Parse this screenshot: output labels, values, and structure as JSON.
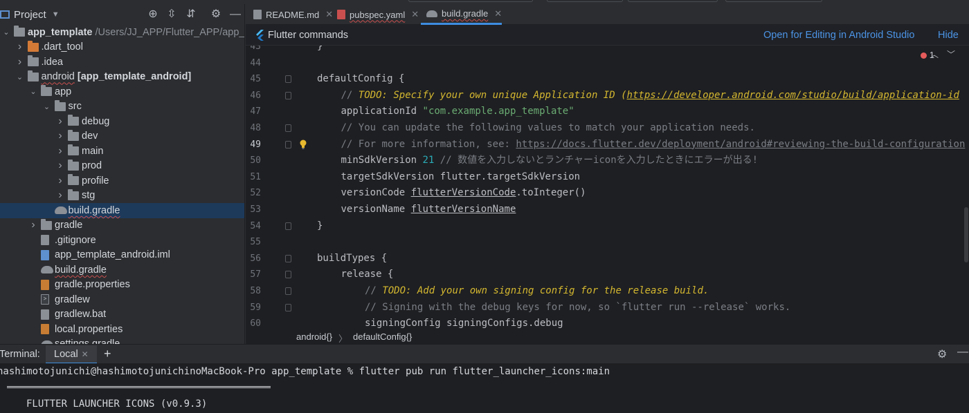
{
  "project_panel": {
    "title": "Project",
    "tree": [
      {
        "label": "app_template",
        "suffix": " /Users/JJ_APP/Flutter_APP/app_",
        "icon": "module-folder-icon",
        "depth": 0,
        "arrow": "expanded",
        "bold": true
      },
      {
        "label": ".dart_tool",
        "icon": "orange-folder-icon",
        "depth": 1,
        "arrow": "collapsed"
      },
      {
        "label": ".idea",
        "icon": "idea-folder-icon",
        "depth": 1,
        "arrow": "collapsed"
      },
      {
        "label": "android",
        "suffix": " [app_template_android]",
        "icon": "module-folder-icon",
        "depth": 1,
        "arrow": "expanded"
      },
      {
        "label": "app",
        "icon": "folder-icon",
        "depth": 2,
        "arrow": "expanded"
      },
      {
        "label": "src",
        "icon": "folder-icon",
        "depth": 3,
        "arrow": "expanded"
      },
      {
        "label": "debug",
        "icon": "folder-icon",
        "depth": 4,
        "arrow": "collapsed"
      },
      {
        "label": "dev",
        "icon": "folder-icon",
        "depth": 4,
        "arrow": "collapsed"
      },
      {
        "label": "main",
        "icon": "folder-icon",
        "depth": 4,
        "arrow": "collapsed"
      },
      {
        "label": "prod",
        "icon": "folder-icon",
        "depth": 4,
        "arrow": "collapsed"
      },
      {
        "label": "profile",
        "icon": "folder-icon",
        "depth": 4,
        "arrow": "collapsed"
      },
      {
        "label": "stg",
        "icon": "folder-icon",
        "depth": 4,
        "arrow": "collapsed"
      },
      {
        "label": "build.gradle",
        "icon": "gradle-icon",
        "depth": 3,
        "arrow": "none",
        "selected": true
      },
      {
        "label": "gradle",
        "icon": "folder-icon",
        "depth": 2,
        "arrow": "collapsed"
      },
      {
        "label": ".gitignore",
        "icon": "gitignore-file-icon",
        "depth": 2,
        "arrow": "none"
      },
      {
        "label": "app_template_android.iml",
        "icon": "iml-file-icon",
        "depth": 2,
        "arrow": "none"
      },
      {
        "label": "build.gradle",
        "icon": "gradle-icon",
        "depth": 2,
        "arrow": "none"
      },
      {
        "label": "gradle.properties",
        "icon": "properties-file-icon",
        "depth": 2,
        "arrow": "none"
      },
      {
        "label": "gradlew",
        "icon": "shell-file-icon",
        "depth": 2,
        "arrow": "none"
      },
      {
        "label": "gradlew.bat",
        "icon": "text-file-icon",
        "depth": 2,
        "arrow": "none"
      },
      {
        "label": "local.properties",
        "icon": "properties-file-icon",
        "depth": 2,
        "arrow": "none"
      },
      {
        "label": "settings.gradle",
        "icon": "gradle-icon",
        "depth": 2,
        "arrow": "none"
      }
    ]
  },
  "tabs": [
    {
      "label": "README.md",
      "icon": "markdown-file-icon"
    },
    {
      "label": "pubspec.yaml",
      "icon": "yaml-file-icon"
    },
    {
      "label": "build.gradle",
      "icon": "gradle-icon",
      "active": true
    }
  ],
  "banner": {
    "title": "Flutter commands",
    "open_link": "Open for Editing in Android Studio",
    "hide_link": "Hide"
  },
  "editor": {
    "error_count": "1",
    "lines": [
      {
        "n": "43",
        "t": [
          {
            "c": "kw",
            "s": "}"
          }
        ],
        "indent": 0
      },
      {
        "n": "44",
        "t": [],
        "indent": 0
      },
      {
        "n": "45",
        "t": [
          {
            "c": "kw",
            "s": "defaultConfig {"
          }
        ],
        "indent": 0,
        "fold": true
      },
      {
        "n": "46",
        "t": [
          {
            "c": "cm",
            "s": "// "
          },
          {
            "c": "todo",
            "s": "TODO: Specify your own unique Application ID ("
          },
          {
            "c": "todo ulink",
            "s": "https://developer.android.com/studio/build/application-id"
          }
        ],
        "indent": 1,
        "fold": true
      },
      {
        "n": "47",
        "t": [
          {
            "c": "kw",
            "s": "applicationId "
          },
          {
            "c": "str",
            "s": "\"com.example.app_template\""
          }
        ],
        "indent": 1
      },
      {
        "n": "48",
        "t": [
          {
            "c": "cm",
            "s": "// You can update the following values to match your application needs."
          }
        ],
        "indent": 1,
        "fold": true
      },
      {
        "n": "49",
        "t": [
          {
            "c": "cm",
            "s": "// For more information, see: "
          },
          {
            "c": "cm ulink",
            "s": "https://docs.flutter.dev/deployment/android#reviewing-the-build-configuration"
          }
        ],
        "indent": 1,
        "fold": true,
        "bulb": true
      },
      {
        "n": "50",
        "t": [
          {
            "c": "kw",
            "s": "minSdkVersion "
          },
          {
            "c": "num",
            "s": "21"
          },
          {
            "c": "cm",
            "s": " // 数値を入力しないとランチャーiconを入力したときにエラーが出る!"
          }
        ],
        "indent": 1
      },
      {
        "n": "51",
        "t": [
          {
            "c": "kw",
            "s": "targetSdkVersion flutter.targetSdkVersion"
          }
        ],
        "indent": 1
      },
      {
        "n": "52",
        "t": [
          {
            "c": "kw",
            "s": "versionCode "
          },
          {
            "c": "kw ulink",
            "s": "flutterVersionCode"
          },
          {
            "c": "kw",
            "s": ".toInteger()"
          }
        ],
        "indent": 1
      },
      {
        "n": "53",
        "t": [
          {
            "c": "kw",
            "s": "versionName "
          },
          {
            "c": "kw ulink",
            "s": "flutterVersionName"
          }
        ],
        "indent": 1
      },
      {
        "n": "54",
        "t": [
          {
            "c": "kw",
            "s": "}"
          }
        ],
        "indent": 0,
        "fold": true
      },
      {
        "n": "55",
        "t": [],
        "indent": 0
      },
      {
        "n": "56",
        "t": [
          {
            "c": "kw",
            "s": "buildTypes {"
          }
        ],
        "indent": 0,
        "fold": true
      },
      {
        "n": "57",
        "t": [
          {
            "c": "kw",
            "s": "release {"
          }
        ],
        "indent": 1,
        "fold": true
      },
      {
        "n": "58",
        "t": [
          {
            "c": "cm",
            "s": "// "
          },
          {
            "c": "todo",
            "s": "TODO: Add your own signing config for the release build."
          }
        ],
        "indent": 2,
        "fold": true
      },
      {
        "n": "59",
        "t": [
          {
            "c": "cm",
            "s": "// Signing with the debug keys for now, so `flutter run --release` works."
          }
        ],
        "indent": 2,
        "fold": true
      },
      {
        "n": "60",
        "t": [
          {
            "c": "kw",
            "s": "signingConfig signingConfigs.debug"
          }
        ],
        "indent": 2
      }
    ]
  },
  "breadcrumb": {
    "first": "android{}",
    "separator": "〉",
    "second": "defaultConfig{}"
  },
  "terminal": {
    "label": "Terminal:",
    "tab": "Local",
    "command_line": "hashimotojunichi@hashimotojunichinoMacBook-Pro app_template % flutter pub run flutter_launcher_icons:main",
    "output_line": "FLUTTER LAUNCHER ICONS (v0.9.3)"
  },
  "colors": {
    "accent": "#3d8de0",
    "link": "#4c94e6",
    "todo": "#d5b830",
    "string": "#6aab73",
    "number": "#2aacb8"
  }
}
